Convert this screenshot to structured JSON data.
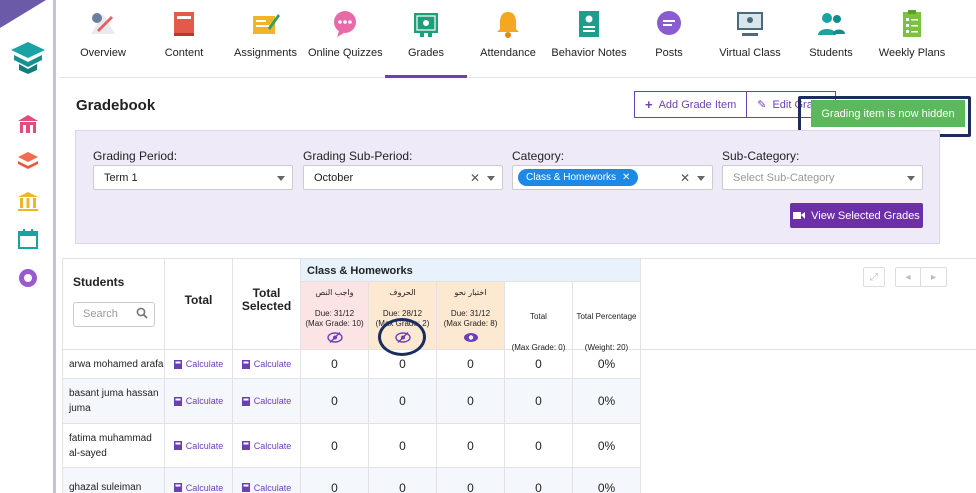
{
  "rail": {
    "icons": [
      "app-logo",
      "home-icon",
      "layers-icon",
      "institution-icon",
      "calendar-icon",
      "support-icon"
    ]
  },
  "nav": {
    "items": [
      {
        "label": "Overview",
        "icon": "overview-icon",
        "color": "#e85d5d"
      },
      {
        "label": "Content",
        "icon": "book-icon",
        "color": "#e35a4c"
      },
      {
        "label": "Assignments",
        "icon": "assignment-icon",
        "color": "#f0b429"
      },
      {
        "label": "Online Quizzes",
        "icon": "quiz-icon",
        "color": "#e86aa8"
      },
      {
        "label": "Grades",
        "icon": "certificate-icon",
        "color": "#1e9e7a"
      },
      {
        "label": "Attendance",
        "icon": "bell-icon",
        "color": "#f5a623"
      },
      {
        "label": "Behavior Notes",
        "icon": "notes-icon",
        "color": "#1e9e8a"
      },
      {
        "label": "Posts",
        "icon": "chat-icon",
        "color": "#8b5ccf"
      },
      {
        "label": "Virtual Class",
        "icon": "screen-icon",
        "color": "#4a6b7c"
      },
      {
        "label": "Students",
        "icon": "users-icon",
        "color": "#1aa3a3"
      },
      {
        "label": "Weekly Plans",
        "icon": "checklist-icon",
        "color": "#7cc242"
      }
    ],
    "active_index": 4
  },
  "gradebook": {
    "title": "Gradebook",
    "add_label": "Add Grade Item",
    "edit_label": "Edit Grade"
  },
  "toast": {
    "message": "Grading item is now hidden"
  },
  "filters": {
    "period_label": "Grading Period:",
    "period_value": "Term 1",
    "subperiod_label": "Grading Sub-Period:",
    "subperiod_value": "October",
    "category_label": "Category:",
    "category_tag": "Class & Homeworks",
    "subcategory_label": "Sub-Category:",
    "subcategory_placeholder": "Select Sub-Category",
    "view_button": "View Selected Grades"
  },
  "table": {
    "students_header": "Students",
    "search_placeholder": "Search",
    "total_header": "Total",
    "total_selected_header": "Total Selected",
    "category_header": "Class & Homeworks",
    "columns": [
      {
        "title": "واجب النص",
        "due": "Due: 31/12",
        "max": "(Max Grade: 10)",
        "eye": "eye-slash-icon"
      },
      {
        "title": "الحروف",
        "due": "Due: 28/12",
        "max": "(Max Grade: 2)",
        "eye": "eye-slash-icon"
      },
      {
        "title": "اختبار نحو",
        "due": "Due: 31/12",
        "max": "(Max Grade: 8)",
        "eye": "eye-icon"
      },
      {
        "title": "Total",
        "due": "",
        "max": "(Max Grade: 0)",
        "eye": ""
      },
      {
        "title": "Total Percentage",
        "due": "",
        "max": "(Weight: 20)",
        "eye": ""
      }
    ],
    "calculate_label": "Calculate",
    "rows": [
      {
        "name": "arwa mohamed arafa",
        "values": [
          "0",
          "0",
          "0",
          "0",
          "0%"
        ]
      },
      {
        "name": "basant juma hassan juma",
        "values": [
          "0",
          "0",
          "0",
          "0",
          "0%"
        ]
      },
      {
        "name": "fatima muhammad al-sayed",
        "values": [
          "0",
          "0",
          "0",
          "0",
          "0%"
        ]
      },
      {
        "name": "ghazal suleiman",
        "values": [
          "0",
          "0",
          "0",
          "0",
          "0%"
        ]
      }
    ]
  },
  "colors": {
    "accent": "#6d3fb5",
    "toast": "#5cb85c",
    "tag": "#1e88e5",
    "annotation": "#1a2d5e"
  }
}
